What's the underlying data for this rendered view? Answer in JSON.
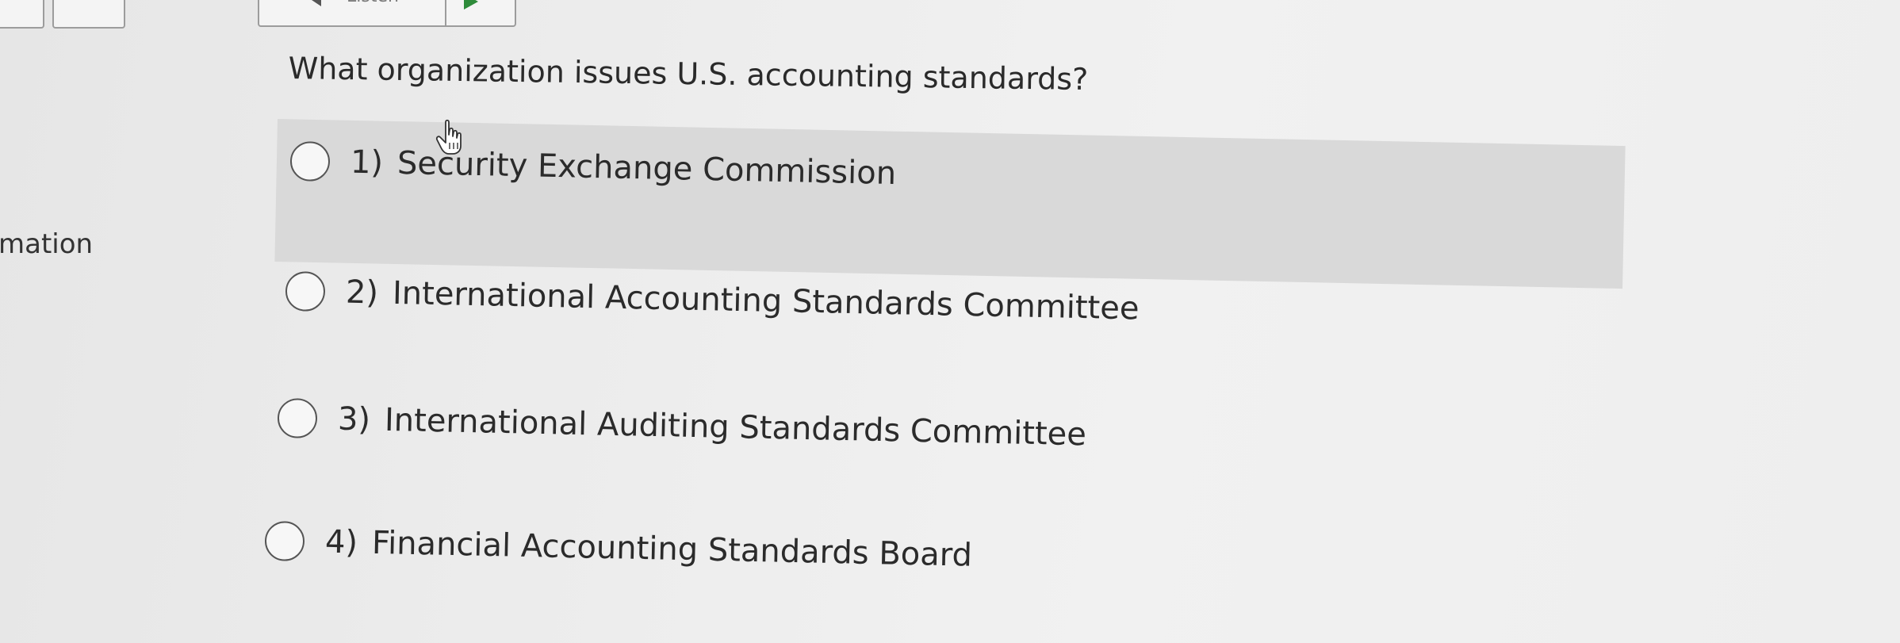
{
  "toolbar": {
    "listen_label": "Listen",
    "listen_icon": "speaker-icon",
    "play_icon": "play-icon",
    "play_color": "#2e8b3a"
  },
  "sidebar": {
    "label_fragment": "mation"
  },
  "question": {
    "text": "What organization issues U.S. accounting standards?",
    "options": [
      {
        "number": "1)",
        "label": "Security Exchange Commission",
        "highlighted": true
      },
      {
        "number": "2)",
        "label": "International Accounting Standards Committee"
      },
      {
        "number": "3)",
        "label": "International Auditing Standards Committee"
      },
      {
        "number": "4)",
        "label": "Financial Accounting Standards Board"
      }
    ]
  },
  "colors": {
    "highlight_bg": "#d9d9d9",
    "text": "#2b2b2b"
  }
}
